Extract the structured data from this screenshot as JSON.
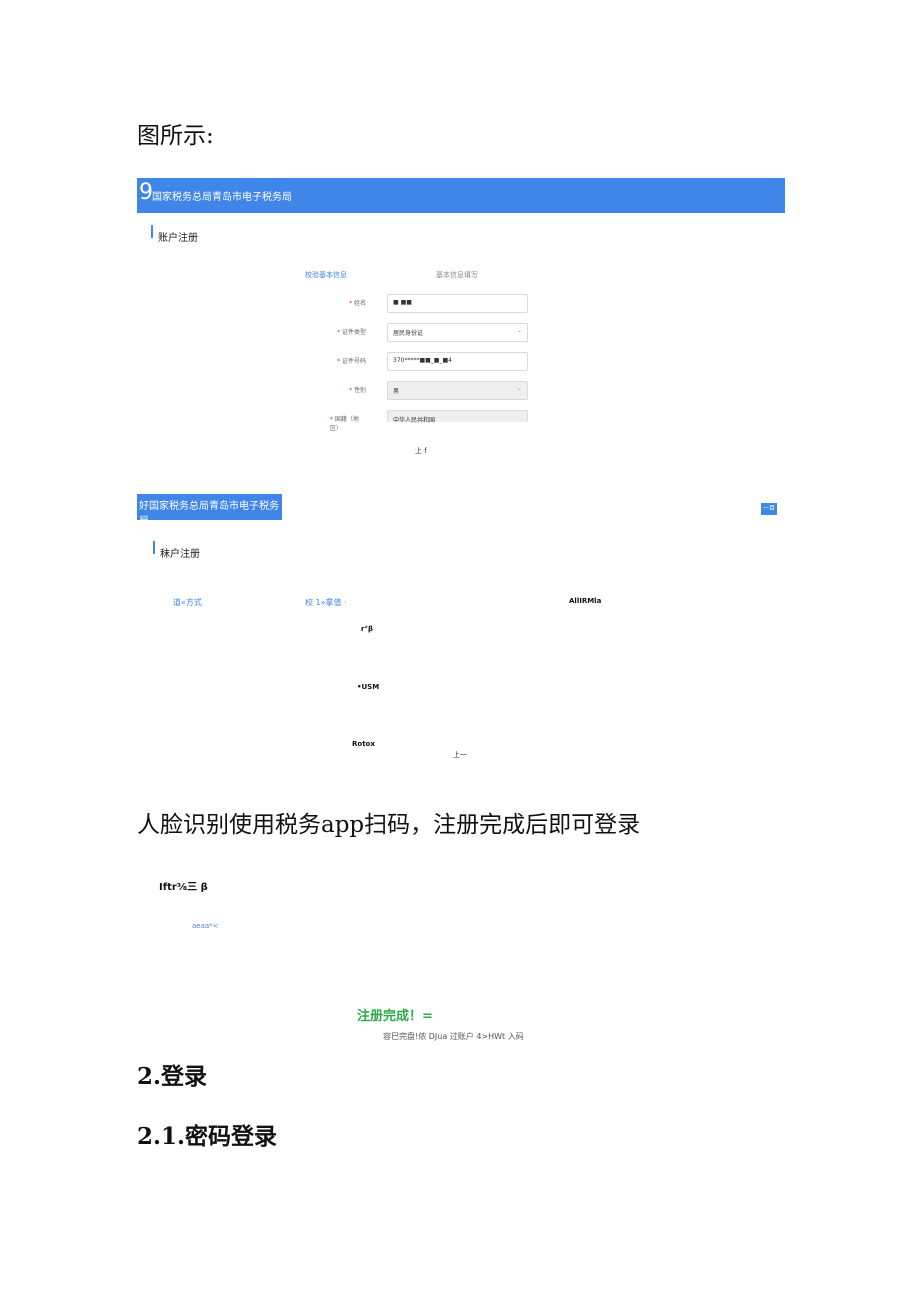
{
  "intro_text": "图所示:",
  "shot1": {
    "banner_num": "9",
    "banner_title": "国家税务总局青岛市电子税务局",
    "section_title": "账户注册",
    "step_active": "校验基本信息",
    "step_next": "基本信息填写",
    "fields": [
      {
        "label": "姓名",
        "value": "■ ■■",
        "chevron": ""
      },
      {
        "label": "证件类型",
        "value": "居民身份证",
        "chevron": "⌄"
      },
      {
        "label": "证件号码",
        "value": "370*****■■_■_■4",
        "chevron": ""
      },
      {
        "label": "性别",
        "value": "男",
        "chevron": "⌄"
      },
      {
        "label": "国籍（地区）",
        "value": "中华人民共和国",
        "chevron": ""
      }
    ],
    "next_button": "上 f"
  },
  "shot2": {
    "banner_title": "好国家税务总局青岛市电子税务局",
    "corner_btn": "一目",
    "section_title": "秣户注册",
    "step1": "道«方式",
    "step2": "校 1»拿值 ·",
    "step3": "AllIRMla",
    "item1": "r°β",
    "item2": "•USM",
    "item3": "Rotox",
    "next_button": "上一"
  },
  "caption": "人脸识别使用税务app扫码，注册完成后即可登录",
  "shot3": {
    "title": "Iftr⅜三 β",
    "faint": "aeaa*<",
    "success": "注册完成！=",
    "success_sub": "容巳完盘!侬 DJua 过账户 4>HWt 入码"
  },
  "heading1": "2.登录",
  "heading2": "2.1.密码登录"
}
